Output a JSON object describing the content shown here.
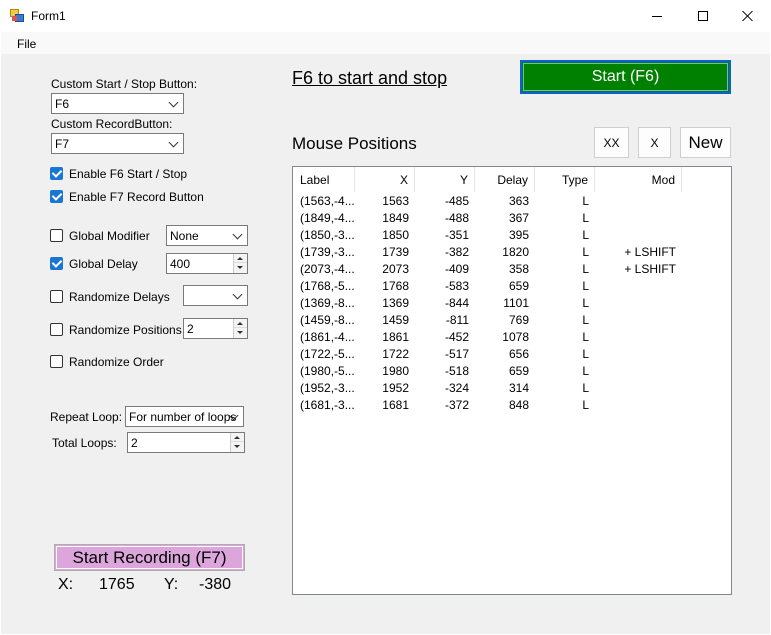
{
  "window": {
    "title": "Form1"
  },
  "menu": {
    "file": "File"
  },
  "settings": {
    "start_stop_label": "Custom Start / Stop Button:",
    "start_stop_value": "F6",
    "record_label": "Custom RecordButton:",
    "record_value": "F7",
    "enable_f6_label": "Enable F6 Start / Stop",
    "enable_f7_label": "Enable F7 Record Button",
    "global_modifier_label": "Global Modifier",
    "global_modifier_value": "None",
    "global_delay_label": "Global Delay",
    "global_delay_value": "400",
    "randomize_delays_label": "Randomize Delays",
    "randomize_delays_value": "",
    "randomize_positions_label": "Randomize Positions",
    "randomize_positions_value": "2",
    "randomize_order_label": "Randomize Order",
    "repeat_loop_label": "Repeat Loop:",
    "repeat_loop_value": "For number of loops",
    "total_loops_label": "Total Loops:",
    "total_loops_value": "2"
  },
  "recording": {
    "button_label": "Start Recording (F7)",
    "x_label": "X:",
    "x_value": "1765",
    "y_label": "Y:",
    "y_value": "-380"
  },
  "header": {
    "hotkey_title": "F6 to start and stop",
    "start_button": "Start (F6)"
  },
  "positions": {
    "title": "Mouse Positions",
    "btn_clear_all": "XX",
    "btn_delete": "X",
    "btn_new": "New",
    "columns": [
      "Label",
      "X",
      "Y",
      "Delay",
      "Type",
      "Mod"
    ],
    "rows": [
      [
        "(1563,-4...",
        "1563",
        "-485",
        "363",
        "L",
        ""
      ],
      [
        "(1849,-4...",
        "1849",
        "-488",
        "367",
        "L",
        ""
      ],
      [
        "(1850,-3...",
        "1850",
        "-351",
        "395",
        "L",
        ""
      ],
      [
        "(1739,-3...",
        "1739",
        "-382",
        "1820",
        "L",
        "+ LSHIFT"
      ],
      [
        "(2073,-4...",
        "2073",
        "-409",
        "358",
        "L",
        "+ LSHIFT"
      ],
      [
        "(1768,-5...",
        "1768",
        "-583",
        "659",
        "L",
        ""
      ],
      [
        "(1369,-8...",
        "1369",
        "-844",
        "1101",
        "L",
        ""
      ],
      [
        "(1459,-8...",
        "1459",
        "-811",
        "769",
        "L",
        ""
      ],
      [
        "(1861,-4...",
        "1861",
        "-452",
        "1078",
        "L",
        ""
      ],
      [
        "(1722,-5...",
        "1722",
        "-517",
        "656",
        "L",
        ""
      ],
      [
        "(1980,-5...",
        "1980",
        "-518",
        "659",
        "L",
        ""
      ],
      [
        "(1952,-3...",
        "1952",
        "-324",
        "314",
        "L",
        ""
      ],
      [
        "(1681,-3...",
        "1681",
        "-372",
        "848",
        "L",
        ""
      ]
    ]
  },
  "colors": {
    "start_button": "#008000",
    "record_button": "#dca6dc",
    "checkbox_checked": "#1976d2"
  }
}
